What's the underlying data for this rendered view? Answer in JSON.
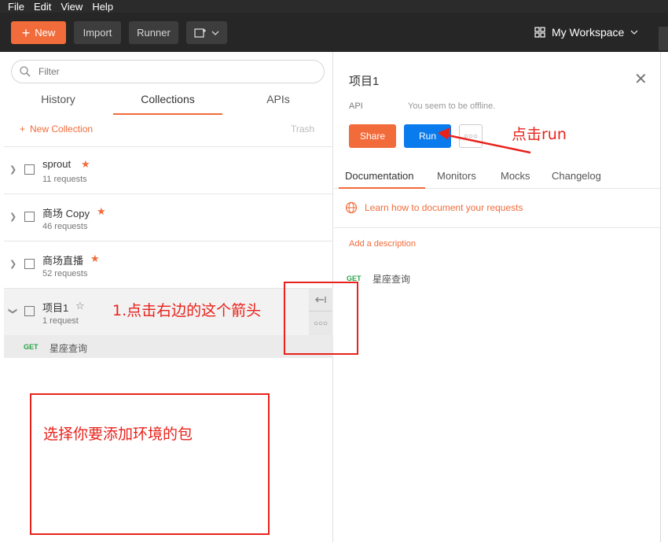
{
  "menu": [
    "File",
    "Edit",
    "View",
    "Help"
  ],
  "toolbar": {
    "new_label": "New",
    "import_label": "Import",
    "runner_label": "Runner",
    "workspace_label": "My Workspace"
  },
  "sidebar": {
    "search_placeholder": "Filter",
    "tabs": [
      "History",
      "Collections",
      "APIs"
    ],
    "active_tab": "Collections",
    "new_collection": "New Collection",
    "trash": "Trash",
    "collections": [
      {
        "name": "sprout",
        "requests": "11 requests",
        "starred": true
      },
      {
        "name": "商场 Copy",
        "requests": "46 requests",
        "starred": true
      },
      {
        "name": "商场直播",
        "requests": "52 requests",
        "starred": true
      },
      {
        "name": "项目1",
        "requests": "1 request",
        "starred": false
      }
    ],
    "expanded_request": {
      "method": "GET",
      "name": "星座查询"
    }
  },
  "panel": {
    "title": "项目1",
    "api_label": "API",
    "offline_text": "You seem to be offline.",
    "share_label": "Share",
    "run_label": "Run",
    "tabs": [
      "Documentation",
      "Monitors",
      "Mocks",
      "Changelog"
    ],
    "active_tab": "Documentation",
    "learn_link": "Learn how to document your requests",
    "add_description": "Add a description",
    "request": {
      "method": "GET",
      "name": "星座查询"
    }
  },
  "annotations": {
    "click_run": "点击run",
    "click_arrow": "1.点击右边的这个箭头",
    "choose_package": "选择你要添加环境的包"
  },
  "colors": {
    "accent_orange": "#f26b3a",
    "run_blue": "#097bed",
    "annotation_red": "#e8221b",
    "get_green": "#27a345"
  }
}
